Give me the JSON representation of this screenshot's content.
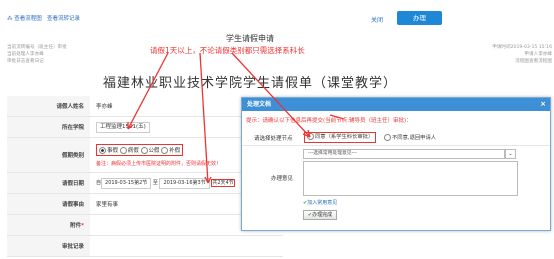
{
  "top_links": {
    "view_flow": "查看流程图",
    "view_records": "查看流转记录"
  },
  "actions": {
    "close": "关闭",
    "handle": "办理"
  },
  "header": {
    "title": "学生请假申请",
    "annotation": "请假1天以上，不论请假类别都只需选择系科长",
    "left_meta": [
      "当前流转编号（班主任）审批",
      "当前处理人李亦峰",
      "审批日志查看日记"
    ],
    "left_log_link": "查看日记",
    "right_meta": [
      "申请时间2019-03-15 15:16",
      "申请人李亦峰",
      "流程图查看流程图"
    ],
    "right_chart_link": "查看流程图"
  },
  "form_title": "福建林业职业技术学院学生请假单（课堂教学）",
  "form": {
    "applicant_label": "请假人姓名",
    "applicant": "李亦峰",
    "class_label": "所在学院",
    "class_value": "工程监理1501(五)",
    "type_label": "假期类别",
    "type_options": [
      "事假",
      "病假",
      "公假",
      "补假"
    ],
    "note": "备注：病假必须上传市医院证明的附件，否则请假无效！",
    "date_label": "请假日期",
    "date_from": "2019-03-15第2节",
    "date_to": "2019-03-16第3节",
    "date_prefix": "自",
    "date_to_word": "至",
    "total": "共2天4节",
    "reason_label": "请假事由",
    "reason": "家里有事",
    "attach_label": "附件",
    "approve_label": "审批记录"
  },
  "dialog": {
    "title": "处理文档",
    "close_icon": "×",
    "hint": "提示：请确认以下信息后再提交(当前节点:辅导员（班主任）审批)：",
    "next_label": "请选择处理节点",
    "next_opt1": "同意（系学生科长审批）",
    "next_opt2": "不同意,退回申请人",
    "select_placeholder": "---选择常用处理意见---",
    "opinion_label": "办理意见",
    "add_common": "加入常用意见",
    "submit": "办理完成"
  }
}
